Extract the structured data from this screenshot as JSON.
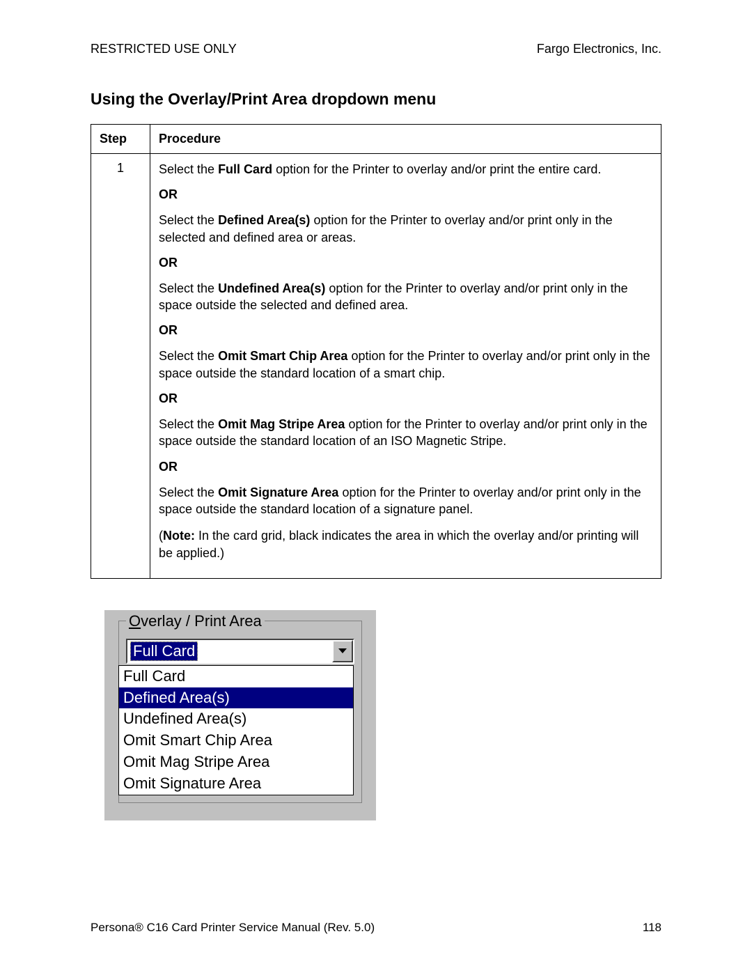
{
  "header": {
    "left": "RESTRICTED USE ONLY",
    "right": "Fargo Electronics, Inc."
  },
  "section_title": "Using the Overlay/Print Area dropdown menu",
  "table": {
    "col1": "Step",
    "col2": "Procedure",
    "step": "1",
    "or": "OR",
    "p1_a": "Select the ",
    "p1_b": "Full Card",
    "p1_c": " option for the Printer to overlay and/or print the entire card.",
    "p2_a": "Select the ",
    "p2_b": "Defined Area(s)",
    "p2_c": " option for the Printer to overlay and/or print only in the selected and defined area or areas.",
    "p3_a": "Select the ",
    "p3_b": "Undefined Area(s)",
    "p3_c": " option for the Printer to overlay and/or print only in the space outside the selected and defined area.",
    "p4_a": "Select the ",
    "p4_b": "Omit Smart Chip Area",
    "p4_c": " option for the Printer to overlay and/or print only in the space outside the standard location of a smart chip.",
    "p5_a": "Select the ",
    "p5_b": "Omit Mag Stripe Area",
    "p5_c": " option for the Printer to overlay and/or print only in the space outside the standard location of an ISO Magnetic Stripe.",
    "p6_a": "Select the ",
    "p6_b": "Omit Signature Area",
    "p6_c": " option for the Printer to overlay and/or print only in the space outside the standard location of a signature panel.",
    "note_a": "(",
    "note_b": "Note:",
    "note_c": " In the card grid, black indicates the area in which the overlay and/or printing will be applied.)"
  },
  "dropdown": {
    "label_u": "O",
    "label_rest": "verlay / Print Area",
    "selected": "Full Card",
    "options": [
      "Full Card",
      "Defined Area(s)",
      "Undefined Area(s)",
      "Omit Smart Chip Area",
      "Omit Mag Stripe Area",
      "Omit Signature Area"
    ],
    "highlighted_index": 1
  },
  "footer": {
    "left": "Persona® C16 Card Printer Service Manual (Rev. 5.0)",
    "page": "118"
  }
}
